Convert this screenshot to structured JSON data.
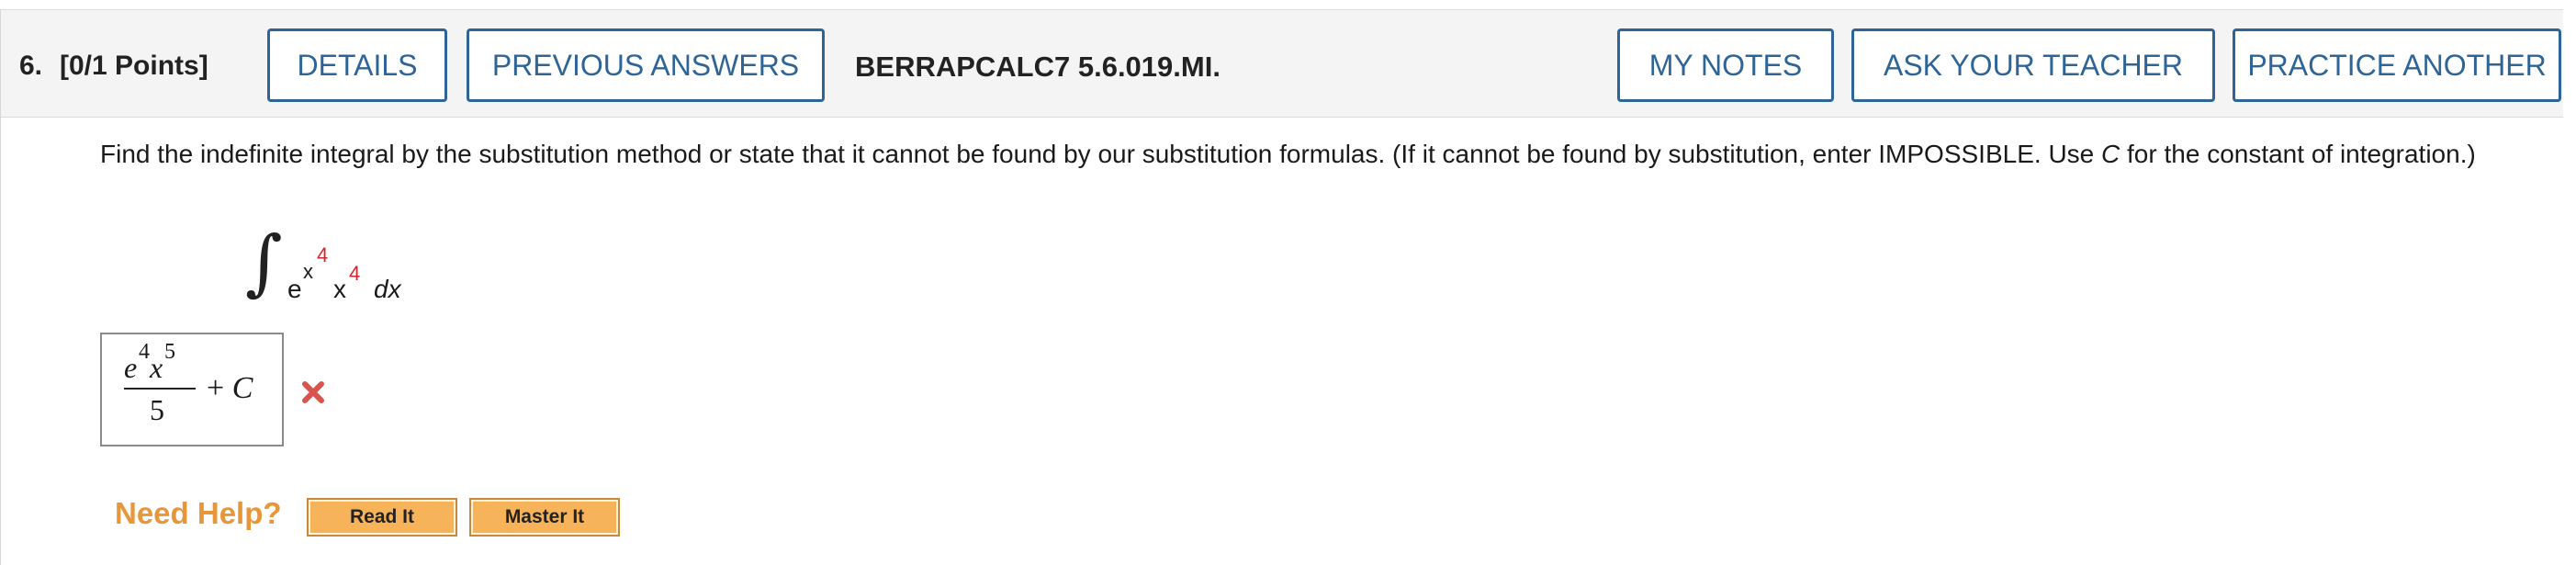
{
  "question": {
    "number": "6.",
    "points": "[0/1 Points]",
    "id": "BERRAPCALC7 5.6.019.MI."
  },
  "toolbar": {
    "details_label": "DETAILS",
    "previous_answers_label": "PREVIOUS ANSWERS",
    "my_notes_label": "MY NOTES",
    "ask_teacher_label": "ASK YOUR TEACHER",
    "practice_another_label": "PRACTICE ANOTHER"
  },
  "prompt": {
    "text_before_c": "Find the indefinite integral by the substitution method or state that it cannot be found by our substitution formulas. (If it cannot be found by substitution, enter IMPOSSIBLE. Use ",
    "c_symbol": "C",
    "text_after_c": " for the constant of integration.)"
  },
  "integral": {
    "sign": "∫",
    "base_e": "e",
    "exp_x": "x",
    "exp_power": "4",
    "factor_x": "x",
    "factor_power": "4",
    "differential": "dx"
  },
  "answer": {
    "num_e": "e",
    "num_exp": "4",
    "num_x": "x",
    "num_x_exp": "5",
    "denominator": "5",
    "plus": "+ ",
    "constant": "C",
    "status": "incorrect"
  },
  "help": {
    "label": "Need Help?",
    "read_it": "Read It",
    "master_it": "Master It"
  },
  "colors": {
    "accent": "#2e6596",
    "error": "#d9534f",
    "help_orange": "#e8963a"
  }
}
